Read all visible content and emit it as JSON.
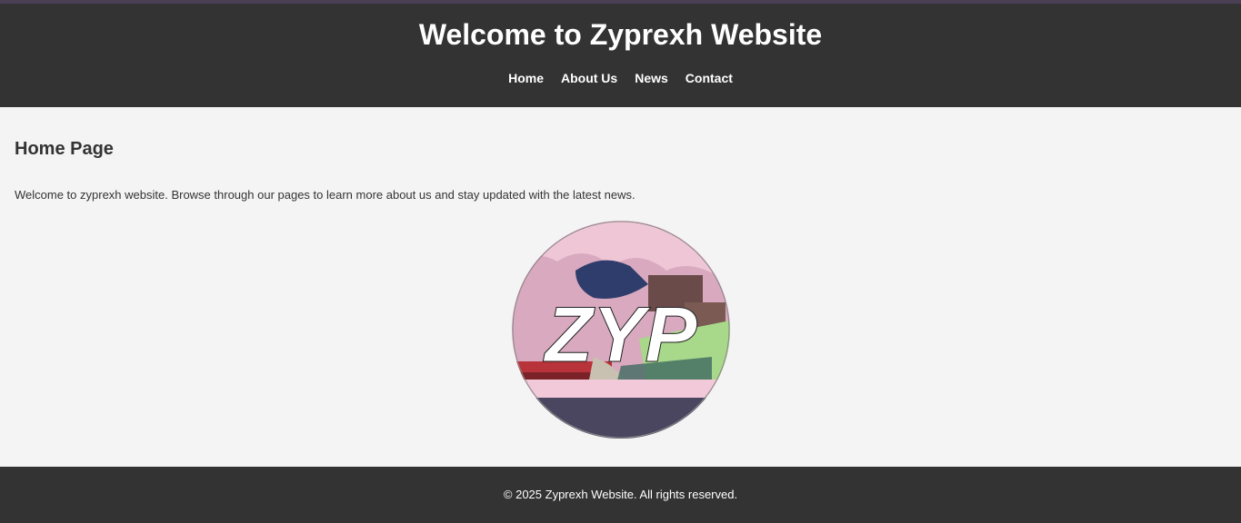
{
  "header": {
    "title": "Welcome to Zyprexh Website",
    "nav": [
      {
        "label": "Home"
      },
      {
        "label": "About Us"
      },
      {
        "label": "News"
      },
      {
        "label": "Contact"
      }
    ]
  },
  "main": {
    "heading": "Home Page",
    "intro": "Welcome to zyprexh website. Browse through our pages to learn more about us and stay updated with the latest news.",
    "logo": {
      "text": "ZYP",
      "colors": {
        "sky": "#2e3d6b",
        "blossom": "#e9b8c9",
        "ground": "#4a4660",
        "bridge": "#b8333a",
        "grass": "#a8d88a"
      }
    }
  },
  "footer": {
    "copyright": "© 2025 Zyprexh Website. All rights reserved."
  },
  "theme": {
    "header_bg": "#333333",
    "body_bg": "#f4f4f4",
    "accent_stripe": "#4a3f55"
  }
}
